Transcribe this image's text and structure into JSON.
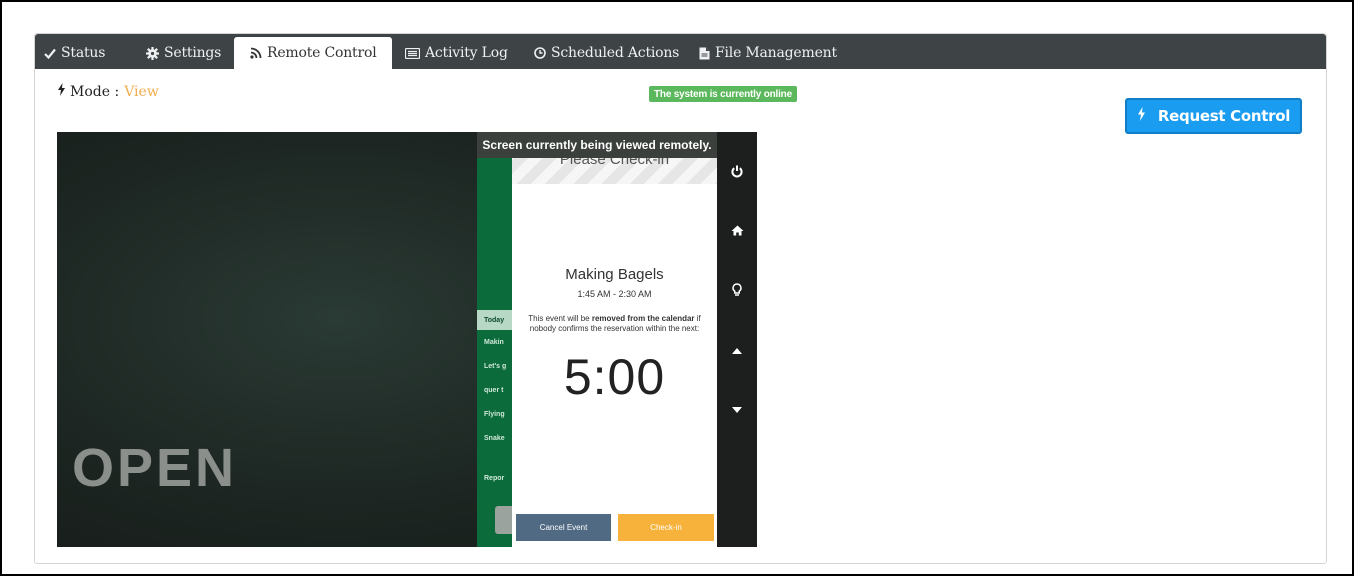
{
  "tabs": [
    {
      "label": "Status",
      "icon": "check-icon"
    },
    {
      "label": "Settings",
      "icon": "gear-icon"
    },
    {
      "label": "Remote Control",
      "icon": "rss-icon",
      "active": true
    },
    {
      "label": "Activity Log",
      "icon": "list-icon"
    },
    {
      "label": "Scheduled Actions",
      "icon": "clock-icon"
    },
    {
      "label": "File Management",
      "icon": "file-icon"
    }
  ],
  "mode": {
    "label": "Mode :",
    "value": "View"
  },
  "status_badge": "The system is currently online",
  "request_control": "Request Control",
  "remote": {
    "banner": "Screen currently being viewed remotely.",
    "background_text": "OPEN",
    "list_items": [
      "Today",
      "Makin",
      "Let's g",
      "quer t",
      "Flying",
      "Snake",
      "Repor"
    ],
    "modal": {
      "title": "Please Check-in",
      "event_name": "Making Bagels",
      "event_time": "1:45 AM - 2:30 AM",
      "msg_pre": "This event will be ",
      "msg_bold1": "removed from the calendar",
      "msg_post": " if nobody confirms the reservation within the next:",
      "timer": "5:00",
      "cancel_label": "Cancel Event",
      "checkin_label": "Check-in"
    },
    "sidebar_icons": [
      "power-icon",
      "home-icon",
      "lightbulb-icon",
      "caret-up-icon",
      "caret-down-icon"
    ]
  },
  "colors": {
    "tabbar": "#3e4346",
    "online_badge": "#5cb85c",
    "mode_value": "#f0ad4e",
    "request_button": "#1a9cf0",
    "cancel_button": "#4f6a82",
    "checkin_button": "#f7b23b",
    "screen_green": "#0b6b3a"
  }
}
